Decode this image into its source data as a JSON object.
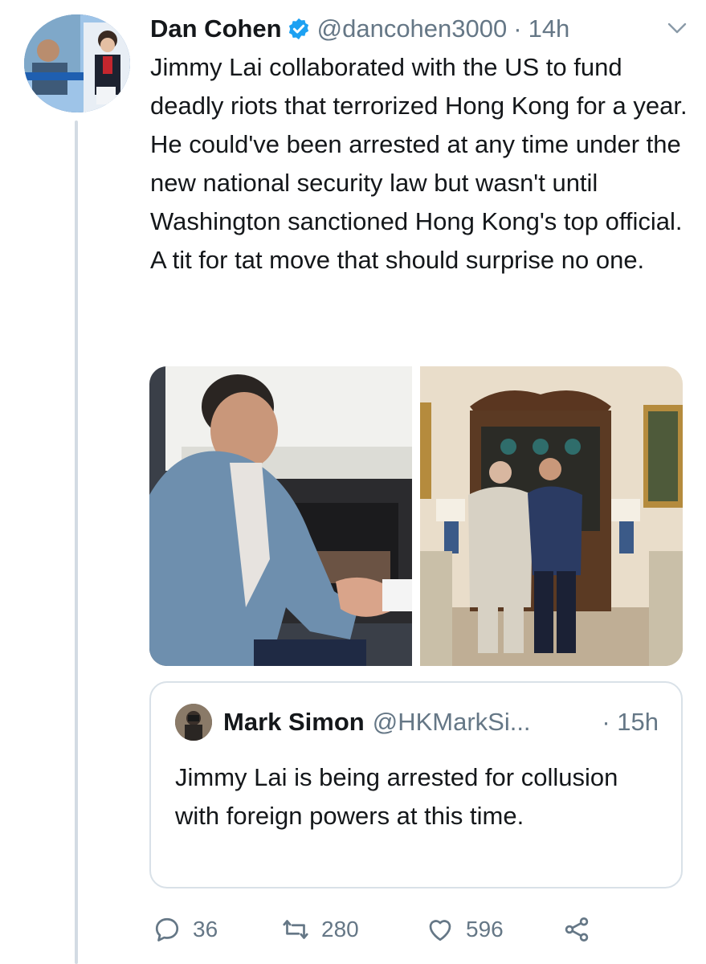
{
  "tweet": {
    "author_name": "Dan Cohen",
    "handle": "@dancohen3000",
    "separator": "·",
    "time": "14h",
    "text": "Jimmy Lai collaborated with the US to fund deadly riots that terrorized Hong Kong for a year. He could've been arrested at any time under the new national security law but wasn't until Washington sanctioned Hong Kong's top official. A tit for tat move that should surprise no one."
  },
  "quoted_tweet": {
    "author_name": "Mark Simon",
    "handle": "@HKMarkSi...",
    "separator": "·",
    "time": "15h",
    "text": "Jimmy Lai is being arrested for collusion with foreign powers at this time."
  },
  "actions": {
    "replies": "36",
    "retweets": "280",
    "likes": "596"
  },
  "icons": {
    "verified": "verified-badge-icon",
    "caret": "chevron-down-icon",
    "reply": "reply-icon",
    "retweet": "retweet-icon",
    "like": "heart-icon",
    "share": "share-icon"
  },
  "colors": {
    "verified_blue": "#1da1f2",
    "secondary_text": "#657786",
    "thread_line": "#d3dbe3",
    "border": "#d9e1e8"
  }
}
